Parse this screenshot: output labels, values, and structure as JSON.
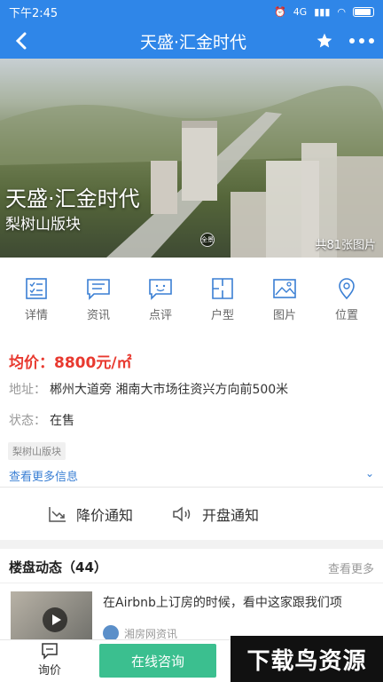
{
  "status_bar": {
    "time": "下午2:45",
    "network": "4G"
  },
  "nav": {
    "title": "天盛·汇金时代"
  },
  "hero": {
    "title": "天盛·汇金时代",
    "subtitle": "梨树山版块",
    "photo_count": "共81张图片",
    "pano_label": "全景"
  },
  "tabs": [
    {
      "label": "详情",
      "icon": "details-icon"
    },
    {
      "label": "资讯",
      "icon": "news-icon"
    },
    {
      "label": "点评",
      "icon": "review-icon"
    },
    {
      "label": "户型",
      "icon": "floorplan-icon"
    },
    {
      "label": "图片",
      "icon": "image-icon"
    },
    {
      "label": "位置",
      "icon": "location-icon"
    }
  ],
  "price": {
    "text": "均价：8800元/㎡"
  },
  "address": {
    "label": "地址：",
    "value": "郴州大道旁 湘南大市场往资兴方向前500米"
  },
  "status": {
    "label": "状态：",
    "value": "在售"
  },
  "tag": "梨树山版块",
  "more_info": "查看更多信息",
  "notify": {
    "price_drop": "降价通知",
    "opening": "开盘通知"
  },
  "news": {
    "header": "楼盘动态（44）",
    "more": "查看更多",
    "item_text": "在Airbnb上订房的时候，看中这家跟我们项",
    "author": "湘房网资讯"
  },
  "bottom": {
    "ask": "询价",
    "consult": "在线咨询"
  },
  "watermark": "下载鸟资源",
  "colors": {
    "primary": "#2f86e8",
    "price": "#e8392f",
    "link": "#3a7fd4",
    "consult": "#3bbf8f"
  }
}
